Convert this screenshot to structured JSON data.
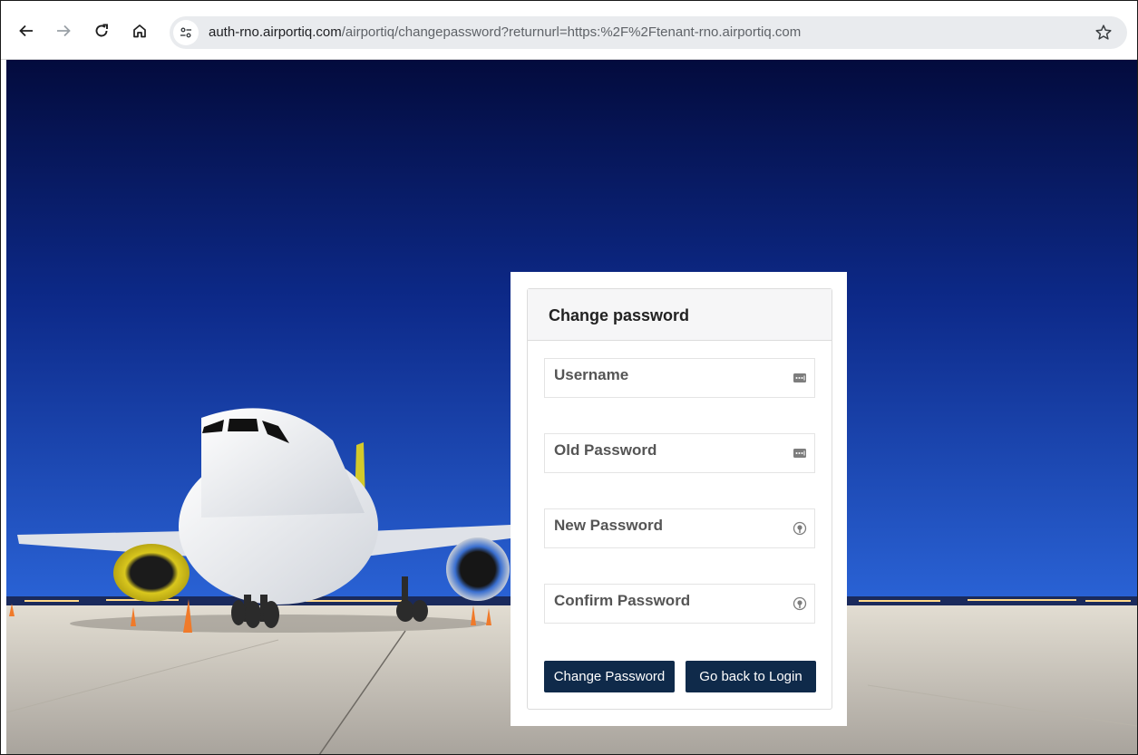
{
  "browser": {
    "url_host": "auth-rno.airportiq.com",
    "url_path": "/airportiq/changepassword?returnurl=https:%2F%2Ftenant-rno.airportiq.com",
    "icons": {
      "back": "arrow-left-icon",
      "forward": "arrow-right-icon",
      "reload": "reload-icon",
      "home": "home-icon",
      "site_info": "site-settings-icon",
      "bookmark": "star-icon"
    }
  },
  "form": {
    "title": "Change password",
    "fields": [
      {
        "label": "Username",
        "icon": "password-manager-key-icon"
      },
      {
        "label": "Old Password",
        "icon": "password-manager-key-icon"
      },
      {
        "label": "New Password",
        "icon": "password-generator-icon"
      },
      {
        "label": "Confirm Password",
        "icon": "password-generator-icon"
      }
    ],
    "buttons": {
      "submit": "Change Password",
      "back": "Go back to Login"
    }
  },
  "colors": {
    "button_bg": "#0f2a4a",
    "sky_top": "#030b3d",
    "sky_bottom": "#2a63d6",
    "tarmac": "#c9c4bb"
  }
}
